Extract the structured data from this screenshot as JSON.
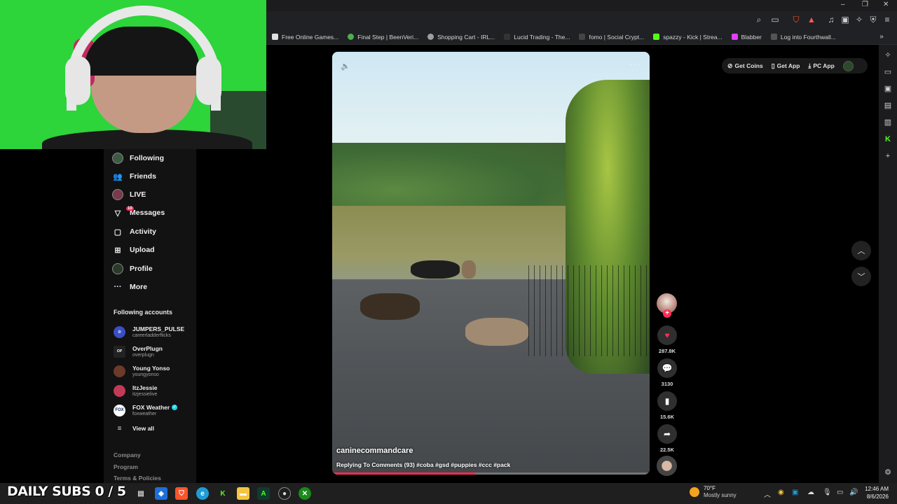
{
  "browser": {
    "bookmarks": [
      {
        "label": "Free Online Games...",
        "color": "#e0e0e0"
      },
      {
        "label": "Final Step | BeenVeri...",
        "color": "#4caf50"
      },
      {
        "label": "Shopping Cart - IRL...",
        "color": "#9e9e9e"
      },
      {
        "label": "Lucid Trading - The...",
        "color": "#333333"
      },
      {
        "label": "fomo | Social Crypt...",
        "color": "#444444"
      },
      {
        "label": "spazzy - Kick | Strea...",
        "color": "#53fc18"
      },
      {
        "label": "Blabber",
        "color": "#e040fb"
      },
      {
        "label": "Log into Fourthwall...",
        "color": "#555555"
      }
    ]
  },
  "sidebar": {
    "nav": [
      {
        "label": "Following",
        "icon": "following-avatar-icon"
      },
      {
        "label": "Friends",
        "icon": "friends-icon"
      },
      {
        "label": "LIVE",
        "icon": "live-icon"
      },
      {
        "label": "Messages",
        "icon": "messages-icon",
        "badge": "10"
      },
      {
        "label": "Activity",
        "icon": "activity-icon"
      },
      {
        "label": "Upload",
        "icon": "upload-icon"
      },
      {
        "label": "Profile",
        "icon": "profile-icon"
      },
      {
        "label": "More",
        "icon": "more-icon"
      }
    ],
    "following_title": "Following accounts",
    "accounts": [
      {
        "name": "JUMPERS_PULSE",
        "handle": "careerladderflicks",
        "color": "#3b4fc4"
      },
      {
        "name": "OverPlugn",
        "handle": "overplugn",
        "color": "#222222"
      },
      {
        "name": "Young Yonso",
        "handle": "youngyonso",
        "color": "#6b3a2a"
      },
      {
        "name": "ItzJessie",
        "handle": "itzjessielive",
        "color": "#c23a55"
      },
      {
        "name": "FOX Weather",
        "handle": "foxweather",
        "color": "#0d2a6b",
        "verified": true
      }
    ],
    "view_all": "View all",
    "footer": [
      "Company",
      "Program",
      "Terms & Policies"
    ]
  },
  "video": {
    "author": "caninecommandcare",
    "description": "Replying To Comments (93) #coba #gsd #puppies #ccc #pack",
    "progress": 0.45
  },
  "actions": {
    "likes": "287.8K",
    "comments": "3130",
    "saves": "15.6K",
    "shares": "22.5K"
  },
  "topbar": {
    "get_coins": "Get Coins",
    "get_app": "Get App",
    "pc_app": "PC App"
  },
  "taskbar": {
    "overlay_text": "DAILY SUBS 0 / 5",
    "weather_temp": "70°F",
    "weather_desc": "Mostly sunny",
    "time": "12:46 AM",
    "date": "8/6/2026"
  }
}
